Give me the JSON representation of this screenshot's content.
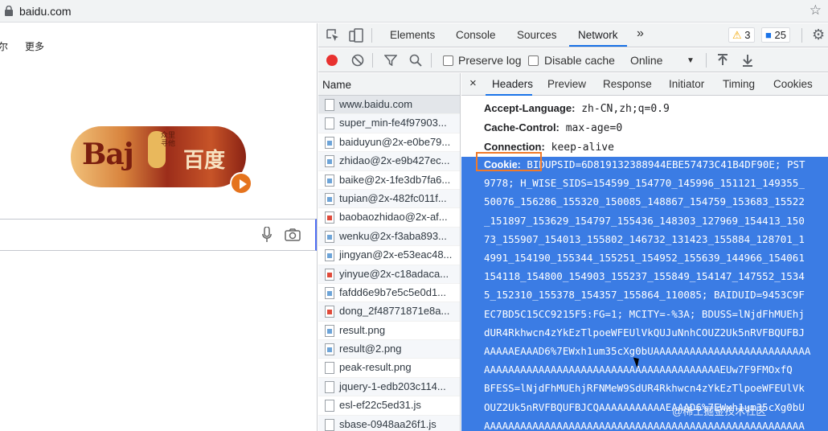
{
  "browser": {
    "url": "baidu.com"
  },
  "page": {
    "partial_text": "尔",
    "more_link": "更多",
    "doodle": {
      "latin": "Baj",
      "chinese": "百度",
      "lantern_text": "众里寻他"
    }
  },
  "devtools": {
    "tabs": [
      "Elements",
      "Console",
      "Sources",
      "Network"
    ],
    "active_tab": "Network",
    "warnings_count": "3",
    "messages_count": "25",
    "toolbar": {
      "preserve_log": "Preserve log",
      "disable_cache": "Disable cache",
      "throttle": "Online"
    },
    "name_header": "Name",
    "requests": [
      "www.baidu.com",
      "super_min-fe4f97903...",
      "baiduyun@2x-e0be79...",
      "zhidao@2x-e9b427ec...",
      "baike@2x-1fe3db7fa6...",
      "tupian@2x-482fc011f...",
      "baobaozhidao@2x-af...",
      "wenku@2x-f3aba893...",
      "jingyan@2x-e53eac48...",
      "yinyue@2x-c18adaca...",
      "fafdd6e9b7e5c5e0d1...",
      "dong_2f48771871e8a...",
      "result.png",
      "result@2.png",
      "peak-result.png",
      "jquery-1-edb203c114...",
      "esl-ef22c5ed31.js",
      "sbase-0948aa26f1.js"
    ],
    "detail_tabs": [
      "Headers",
      "Preview",
      "Response",
      "Initiator",
      "Timing",
      "Cookies"
    ],
    "headers": [
      {
        "name": "Accept-Language:",
        "value": "zh-CN,zh;q=0.9"
      },
      {
        "name": "Cache-Control:",
        "value": "max-age=0"
      },
      {
        "name": "Connection:",
        "value": "keep-alive"
      }
    ],
    "cookie": {
      "name": "Cookie:",
      "lines": [
        "BIDUPSID=6D819132388944EBE57473C41B4DF90E; PST",
        "9778; H_WISE_SIDS=154599_154770_145996_151121_149355_",
        "50076_156286_155320_150085_148867_154759_153683_15522",
        "_151897_153629_154797_155436_148303_127969_154413_150",
        "73_155907_154013_155802_146732_131423_155884_128701_1",
        "4991_154190_155344_155251_154952_155639_144966_154061",
        "154118_154800_154903_155237_155849_154147_147552_1534",
        "5_152310_155378_154357_155864_110085; BAIDUID=9453C9F",
        "EC7BD5C15CC9215F5:FG=1; MCITY=-%3A; BDUSS=lNjdFhMUEhj",
        "dUR4Rkhwcn4zYkEzTlpoeWFEUlVkQUJuNnhCOUZ2Uk5nRVFBQUFBJ",
        "AAAAAEAAAD6%7EWxh1um35cXg0bUAAAAAAAAAAAAAAAAAAAAAAAAAA",
        "AAAAAAAAAAAAAAAAAAAAAAAAAAAAAAAAAAAAAAAEUw7F9FMOxfQ",
        "BFESS=lNjdFhMUEhjRFNMeW9SdUR4Rkhwcn4zYkEzTlpoeWFEUlVk",
        "OUZ2Uk5nRVFBQUFBJCQAAAAAAAAAAAEAAAD6%7EWxh1um35cXg0bU",
        "AAAAAAAAAAAAAAAAAAAAAAAAAAAAAAAAAAAAAAAAAAAAAAAAAAAAA"
      ]
    },
    "watermark": "@稀土掘金技术社区"
  }
}
